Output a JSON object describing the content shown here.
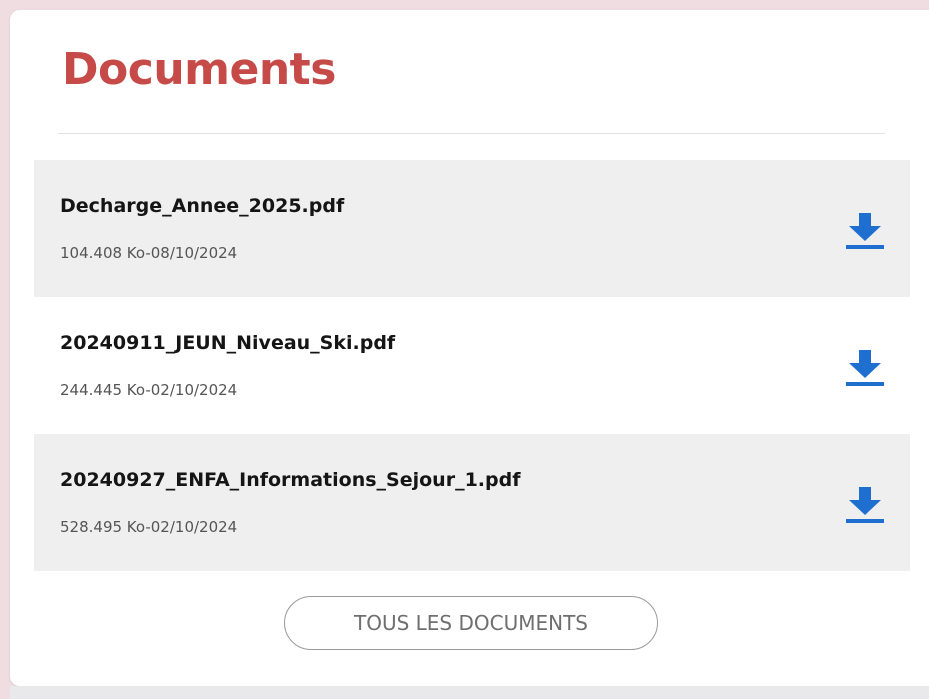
{
  "title": "Documents",
  "documents": [
    {
      "name": "Decharge_Annee_2025.pdf",
      "meta": "104.408 Ko-08/10/2024"
    },
    {
      "name": "20240911_JEUN_Niveau_Ski.pdf",
      "meta": "244.445 Ko-02/10/2024"
    },
    {
      "name": "20240927_ENFA_Informations_Sejour_1.pdf",
      "meta": "528.495 Ko-02/10/2024"
    }
  ],
  "all_documents_label": "TOUS LES DOCUMENTS",
  "icons": {
    "download": "download-icon"
  },
  "colors": {
    "title": "#c64a47",
    "download_icon": "#1f6fd1",
    "row_shade": "#efefef",
    "page_background": "#efdde2"
  }
}
